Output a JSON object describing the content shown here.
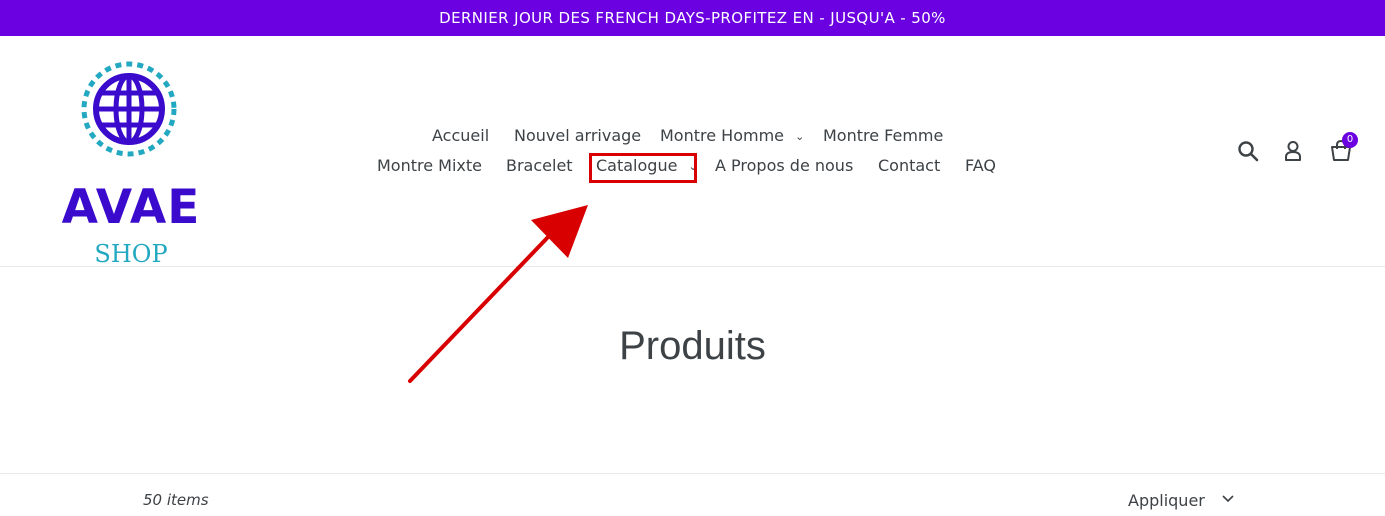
{
  "announcement": {
    "text": "DERNIER JOUR DES FRENCH DAYS-PROFITEZ EN - JUSQU'A - 50%"
  },
  "logo": {
    "main": "AVAE",
    "sub": "SHOP"
  },
  "nav": {
    "row1": [
      {
        "label": "Accueil"
      },
      {
        "label": "Nouvel arrivage"
      },
      {
        "label": "Montre Homme",
        "dropdown": true
      },
      {
        "label": "Montre Femme"
      }
    ],
    "row2": [
      {
        "label": "Montre Mixte"
      },
      {
        "label": "Bracelet"
      },
      {
        "label": "Catalogue",
        "dropdown": true,
        "highlighted": true
      },
      {
        "label": "A Propos de nous"
      },
      {
        "label": "Contact"
      },
      {
        "label": "FAQ"
      }
    ]
  },
  "header_icons": {
    "search": "search-icon",
    "account": "user-icon",
    "cart": "cart-icon",
    "cart_count": "0"
  },
  "page": {
    "title": "Produits"
  },
  "toolbar": {
    "items_count": "50 items",
    "sort_value": "Appliquer"
  },
  "colors": {
    "accent": "#6b00e0",
    "logo_primary": "#3a0bcc",
    "logo_secondary": "#22a8c0",
    "annotation": "#d80000"
  }
}
